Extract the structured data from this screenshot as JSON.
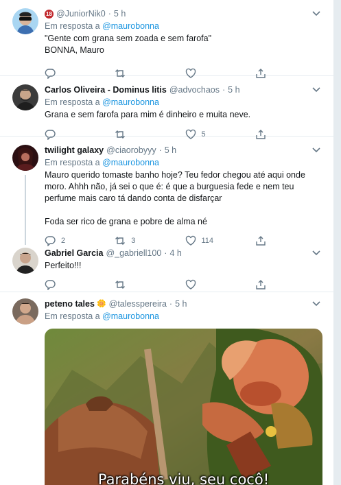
{
  "tweets": [
    {
      "name": "",
      "badge": "18",
      "handle": "@JuniorNik0",
      "time": "5 h",
      "reply_prefix": "Em resposta a",
      "reply_handle": "@maurobonna",
      "text": "\"Gente com grana sem zoada e sem farofa\"\nBONNA, Mauro",
      "replies": "",
      "retweets": "",
      "likes": ""
    },
    {
      "name": "Carlos Oliveira - Dominus litis",
      "handle": "@advochaos",
      "time": "5 h",
      "reply_prefix": "Em resposta a",
      "reply_handle": "@maurobonna",
      "text": "Grana e sem farofa para mim é dinheiro e muita neve.",
      "replies": "",
      "retweets": "",
      "likes": "5"
    },
    {
      "name": "twilight galaxy",
      "handle": "@ciaorobyyy",
      "time": "5 h",
      "reply_prefix": "Em resposta a",
      "reply_handle": "@maurobonna",
      "text": "Mauro querido tomaste banho hoje? Teu fedor chegou até aqui onde moro. Ahhh não, já sei o que é: é que a burguesia fede e nem teu perfume mais caro tá dando conta de disfarçar\n\nFoda ser rico de grana e pobre de alma né",
      "replies": "2",
      "retweets": "3",
      "likes": "114"
    },
    {
      "name": "Gabriel Garcia",
      "handle": "@_gabriell100",
      "time": "4 h",
      "text": "Perfeito!!!",
      "replies": "",
      "retweets": "",
      "likes": ""
    },
    {
      "name": "peteno tales",
      "name_emoji": "🌼",
      "handle": "@talesspereira",
      "time": "5 h",
      "reply_prefix": "Em resposta a",
      "reply_handle": "@maurobonna",
      "media_caption": "Parabéns viu, seu cocô!"
    }
  ],
  "icons": [
    "chevron-down-icon",
    "reply-icon",
    "retweet-icon",
    "like-icon",
    "share-icon"
  ],
  "colors": {
    "link": "#1b95e0",
    "muted": "#657786",
    "divider": "#e6ecf0",
    "badge": "#c0282d"
  }
}
